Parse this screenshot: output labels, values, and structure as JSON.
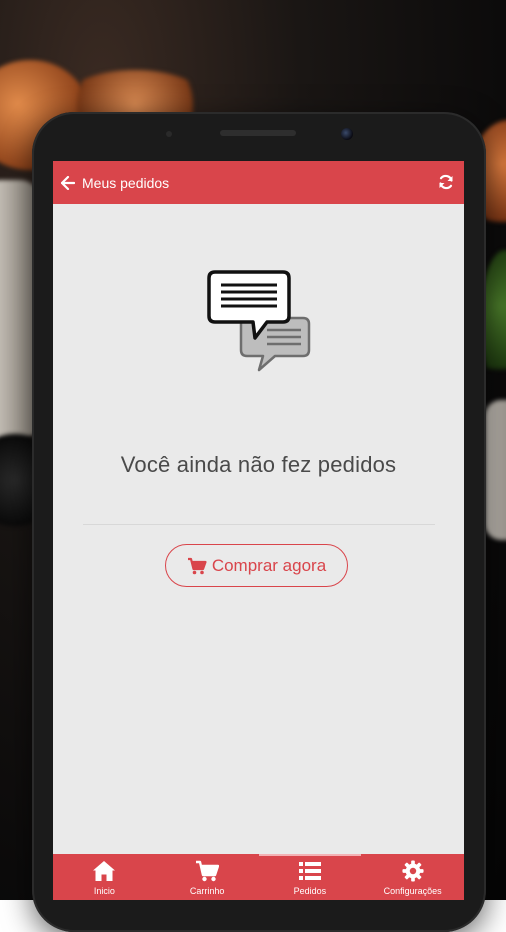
{
  "topbar": {
    "back_icon": "arrow-left-icon",
    "title": "Meus pedidos",
    "refresh_icon": "refresh-icon"
  },
  "empty_state": {
    "icon": "chat-bubbles-icon",
    "message": "Você ainda não fez pedidos",
    "button_icon": "cart-icon",
    "button_label": "Comprar agora"
  },
  "bottom_nav": {
    "items": [
      {
        "label": "Inicio",
        "icon": "home-icon"
      },
      {
        "label": "Carrinho",
        "icon": "cart-icon"
      },
      {
        "label": "Pedidos",
        "icon": "list-icon"
      },
      {
        "label": "Configurações",
        "icon": "gear-icon"
      }
    ],
    "active_index": 2
  },
  "colors": {
    "accent": "#d9454b",
    "screen_bg": "#eaeaea",
    "text": "#4a4a4a"
  }
}
